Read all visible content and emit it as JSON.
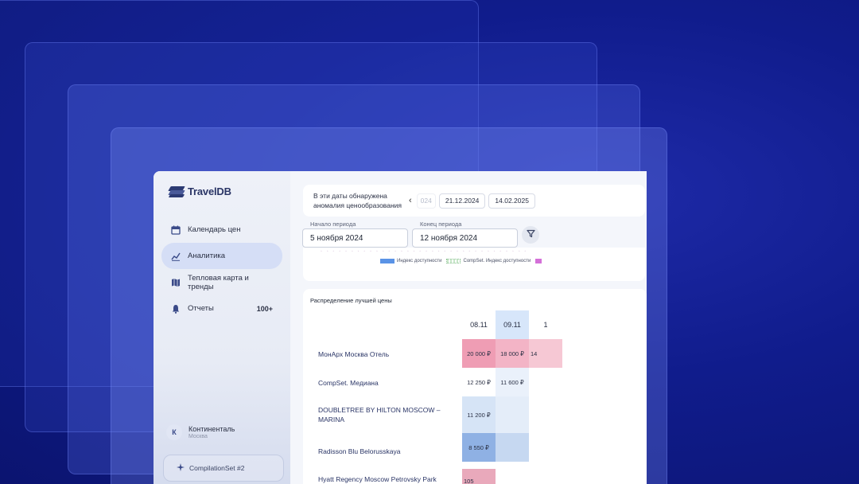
{
  "app": {
    "brand": "TravelDB"
  },
  "sidebar": {
    "items": [
      {
        "label": "Календарь цен",
        "icon": "calendar-icon",
        "active": false
      },
      {
        "label": "Аналитика",
        "icon": "chart-line-icon",
        "active": true
      },
      {
        "label": "Тепловая карта и тренды",
        "icon": "map-icon",
        "active": false
      },
      {
        "label": "Отчеты",
        "icon": "bell-icon",
        "active": false,
        "badge": "100+"
      }
    ],
    "org": {
      "avatar": "К",
      "name": "Континенталь",
      "city": "Москва"
    },
    "compset": {
      "label": "CompilationSet #2",
      "icon": "sparkle-icon"
    }
  },
  "anomaly": {
    "text": "В эти даты обнаружена аномалия ценообразования",
    "dates": [
      "024",
      "21.12.2024",
      "14.02.2025"
    ]
  },
  "period": {
    "start_label": "Начало периода",
    "start_value": "5 ноября 2024",
    "end_label": "Конец периода",
    "end_value": "12 ноября 2024"
  },
  "legend": {
    "items": [
      {
        "label": "Индекс доступности",
        "color": "#5a93e6"
      },
      {
        "label": "CompSet. Индекс доступности",
        "color": "#8fc294"
      }
    ]
  },
  "distribution": {
    "title": "Распределение лучшей цены",
    "columns": [
      "08.11",
      "09.11",
      "1"
    ],
    "rows": [
      {
        "name": "МонАрх Москва Отель",
        "cells": [
          "20 000 ₽",
          "18 000 ₽",
          "14"
        ]
      },
      {
        "name": "CompSet. Медиана",
        "cells": [
          "12 250 ₽",
          "11 600 ₽",
          ""
        ]
      },
      {
        "name": "DOUBLETREE BY HILTON MOSCOW – MARINA",
        "cells": [
          "11 200 ₽",
          "",
          ""
        ]
      },
      {
        "name": "Radisson Blu Belorusskaya",
        "cells": [
          "8 550 ₽",
          "",
          ""
        ]
      },
      {
        "name": "Hyatt Regency Moscow Petrovsky Park",
        "cells": [
          "105",
          "",
          ""
        ]
      }
    ]
  }
}
